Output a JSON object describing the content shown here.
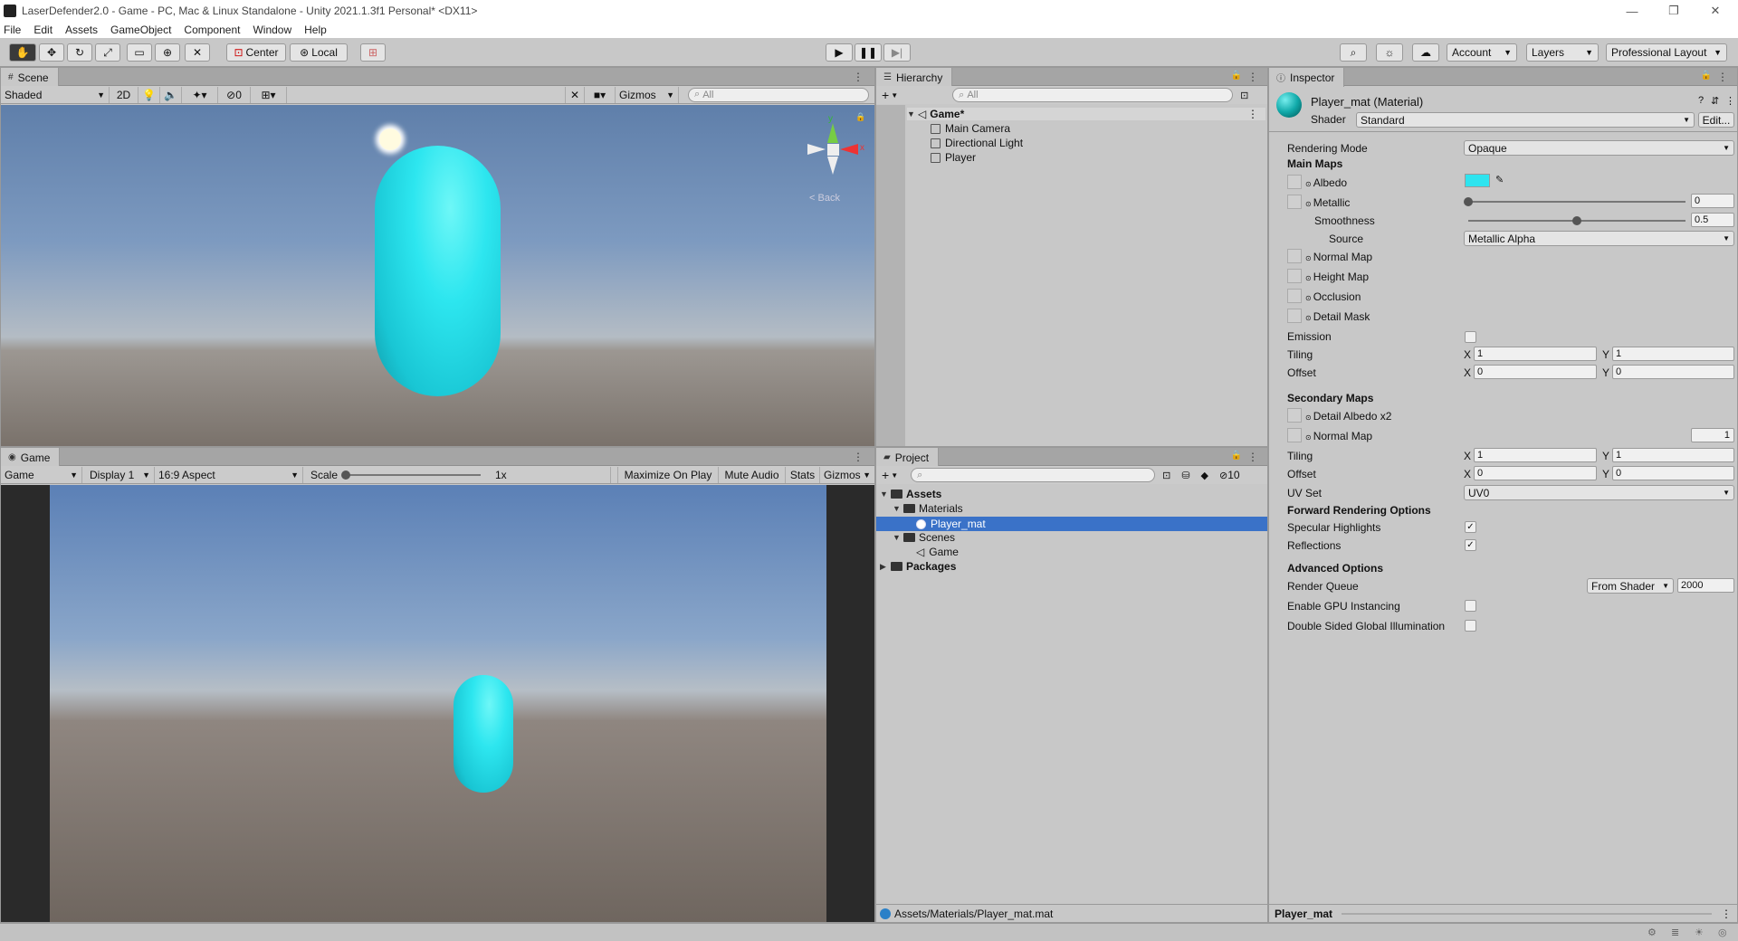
{
  "window": {
    "title": "LaserDefender2.0 - Game - PC, Mac & Linux Standalone - Unity 2021.1.3f1 Personal* <DX11>"
  },
  "menu": [
    "File",
    "Edit",
    "Assets",
    "GameObject",
    "Component",
    "Window",
    "Help"
  ],
  "toolbar": {
    "center_label": "Center",
    "local_label": "Local",
    "account_label": "Account",
    "layers_label": "Layers",
    "layout_label": "Professional Layout"
  },
  "scene": {
    "tab_label": "Scene",
    "shading_mode": "Shaded",
    "mode_2d": "2D",
    "hidden_count": "0",
    "gizmos_label": "Gizmos",
    "search_placeholder": "All",
    "gizmo_back": "Back",
    "axis_y": "y",
    "axis_x": "x"
  },
  "game": {
    "tab_label": "Game",
    "view_label": "Game",
    "display": "Display 1",
    "aspect": "16:9 Aspect",
    "scale_label": "Scale",
    "scale_value": "1x",
    "maximize": "Maximize On Play",
    "mute": "Mute Audio",
    "stats": "Stats",
    "gizmos": "Gizmos"
  },
  "hierarchy": {
    "tab_label": "Hierarchy",
    "search_placeholder": "All",
    "scene_name": "Game*",
    "items": [
      "Main Camera",
      "Directional Light",
      "Player"
    ]
  },
  "project": {
    "tab_label": "Project",
    "hidden_count": "10",
    "tree": {
      "assets": "Assets",
      "materials": "Materials",
      "player_mat": "Player_mat",
      "scenes": "Scenes",
      "game": "Game",
      "packages": "Packages"
    },
    "path": "Assets/Materials/Player_mat.mat"
  },
  "inspector": {
    "tab_label": "Inspector",
    "material_name": "Player_mat (Material)",
    "shader_label": "Shader",
    "shader_value": "Standard",
    "edit_label": "Edit...",
    "rendering_mode_label": "Rendering Mode",
    "rendering_mode_value": "Opaque",
    "main_maps": "Main Maps",
    "albedo": "Albedo",
    "albedo_color": "#2ee4ef",
    "metallic": "Metallic",
    "metallic_value": "0",
    "metallic_level": 0,
    "smoothness": "Smoothness",
    "smoothness_value": "0.5",
    "smoothness_level": 0.5,
    "source": "Source",
    "source_value": "Metallic Alpha",
    "normal_map": "Normal Map",
    "height_map": "Height Map",
    "occlusion": "Occlusion",
    "detail_mask": "Detail Mask",
    "emission": "Emission",
    "tiling": "Tiling",
    "offset": "Offset",
    "x": "X",
    "y": "Y",
    "main_tiling_x": "1",
    "main_tiling_y": "1",
    "main_offset_x": "0",
    "main_offset_y": "0",
    "secondary_maps": "Secondary Maps",
    "detail_albedo": "Detail Albedo x2",
    "sec_normal_map": "Normal Map",
    "sec_normal_value": "1",
    "sec_tiling_x": "1",
    "sec_tiling_y": "1",
    "sec_offset_x": "0",
    "sec_offset_y": "0",
    "uv_set": "UV Set",
    "uv_set_value": "UV0",
    "forward_options": "Forward Rendering Options",
    "specular": "Specular Highlights",
    "reflections": "Reflections",
    "advanced": "Advanced Options",
    "render_queue": "Render Queue",
    "render_queue_mode": "From Shader",
    "render_queue_value": "2000",
    "gpu_instancing": "Enable GPU Instancing",
    "double_sided": "Double Sided Global Illumination",
    "footer_name": "Player_mat"
  },
  "colors": {
    "accent": "#3a72c8",
    "capsule": "#2de6ef"
  }
}
